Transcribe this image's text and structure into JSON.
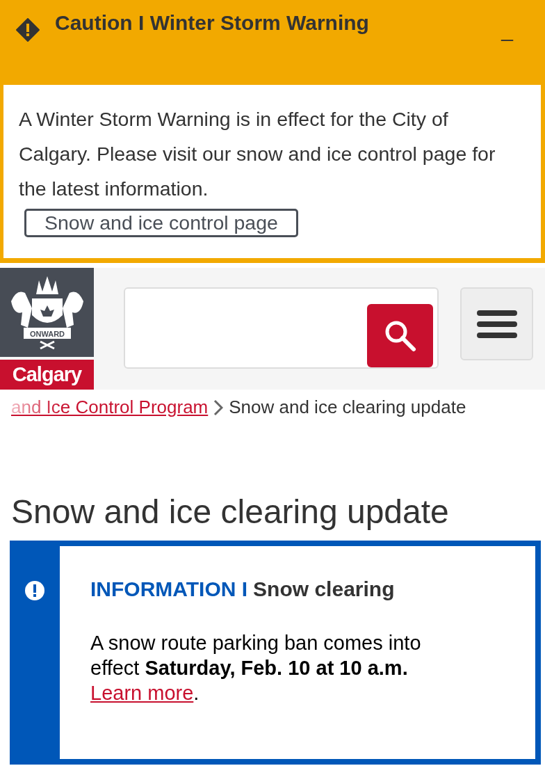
{
  "alert": {
    "title": "Caution I Winter Storm Warning",
    "collapse_label": "_",
    "message": "A Winter Storm Warning is in effect for the City of Calgary. Please visit our snow and ice control page for the latest information.",
    "button": "Snow and ice control page"
  },
  "header": {
    "logo_motto": "ONWARD",
    "logo_wordmark": "Calgary"
  },
  "breadcrumb": {
    "link": "and Ice Control Program",
    "current": "Snow and ice clearing update"
  },
  "page_title": "Snow and ice clearing update",
  "info": {
    "label": "INFORMATION I",
    "title": "Snow clearing",
    "message": "A snow route parking ban comes into effect **Saturday, Feb. 10 at 10 a.m.** ",
    "link": "Learn more",
    "message_end": "."
  }
}
